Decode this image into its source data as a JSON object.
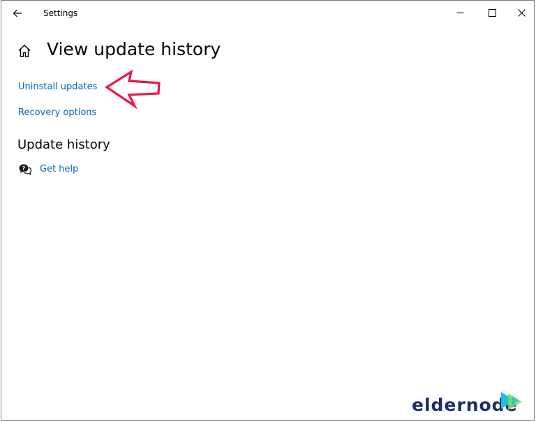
{
  "window": {
    "title": "Settings"
  },
  "page": {
    "title": "View update history",
    "links": {
      "uninstall": "Uninstall updates",
      "recovery": "Recovery options"
    },
    "section_title": "Update history",
    "help_label": "Get help"
  },
  "icons": {
    "back": "back-arrow-icon",
    "home": "home-icon",
    "minimize": "minimize-icon",
    "maximize": "maximize-icon",
    "close": "close-icon",
    "help": "help-chat-icon"
  },
  "annotation": {
    "arrow_color": "#e8184a",
    "points_to": "Uninstall updates"
  },
  "watermark": {
    "text": "eldernode",
    "colors": {
      "text": "#1a2d6b",
      "play_primary": "#19c2d6",
      "play_secondary": "#7fd36b"
    }
  },
  "colors": {
    "link": "#0067c0",
    "background": "#ffffff"
  }
}
